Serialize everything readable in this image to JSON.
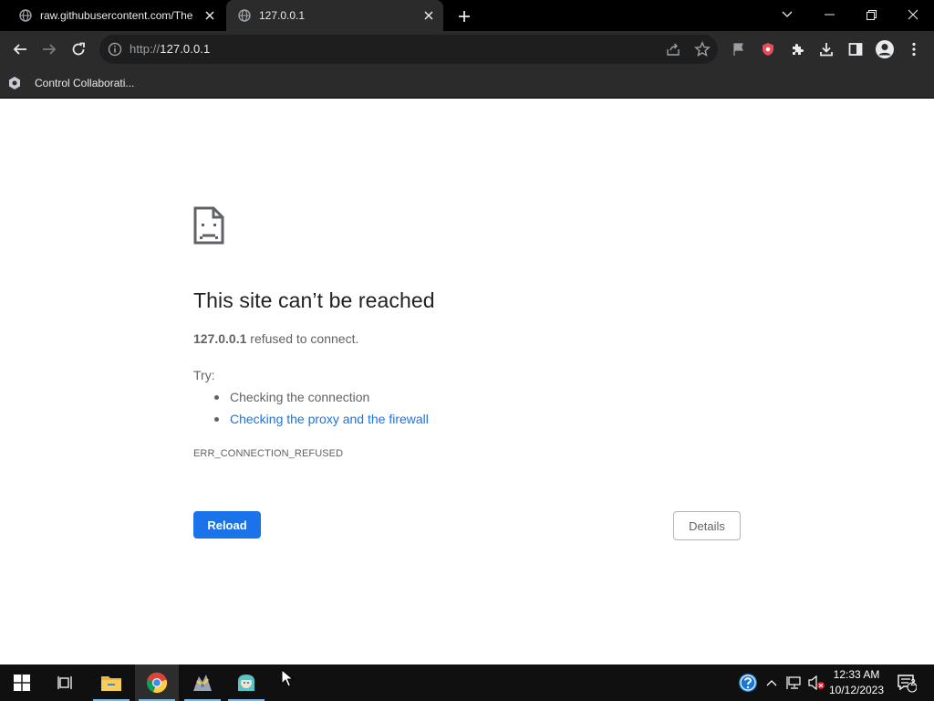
{
  "browser": {
    "tabs": [
      {
        "title": "raw.githubusercontent.com/The",
        "active": false
      },
      {
        "title": "127.0.0.1",
        "active": true
      }
    ],
    "address_bar": {
      "scheme": "http://",
      "host": "127.0.0.1"
    },
    "bookmarks": [
      {
        "label": "Control Collaborati..."
      }
    ]
  },
  "error_page": {
    "title": "This site can’t be reached",
    "host": "127.0.0.1",
    "message": " refused to connect.",
    "try_label": "Try:",
    "suggestions": [
      {
        "text": "Checking the connection",
        "link": false
      },
      {
        "text": "Checking the proxy and the firewall",
        "link": true
      }
    ],
    "error_code": "ERR_CONNECTION_REFUSED",
    "reload_label": "Reload",
    "details_label": "Details"
  },
  "taskbar": {
    "apps": [
      "start-icon",
      "task-view-icon",
      "file-explorer-icon",
      "chrome-icon",
      "control-collaboration-icon",
      "hatsune-app-icon"
    ],
    "clock": {
      "time": "12:33 AM",
      "date": "10/12/2023"
    },
    "notification_count": "2"
  },
  "colors": {
    "accent": "#1a73e8",
    "chrome_bg": "#000000",
    "toolbar_bg": "#2b2b2b",
    "taskbar_bg": "#101010"
  }
}
